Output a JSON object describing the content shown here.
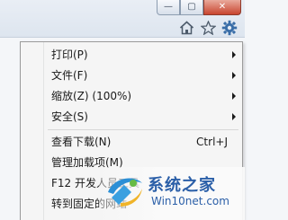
{
  "window": {
    "controls": [
      {
        "name": "minimize-button",
        "glyph": "—"
      },
      {
        "name": "maximize-button",
        "glyph": "▢"
      },
      {
        "name": "close-button",
        "glyph": "✕"
      }
    ]
  },
  "toolbar": {
    "icons": [
      "home-icon",
      "favorites-star-icon",
      "tools-gear-icon"
    ]
  },
  "menu": {
    "items": [
      {
        "label": "打印(P)",
        "shortcut": "",
        "submenu": true
      },
      {
        "label": "文件(F)",
        "shortcut": "",
        "submenu": true
      },
      {
        "label": "缩放(Z) (100%)",
        "shortcut": "",
        "submenu": true
      },
      {
        "label": "安全(S)",
        "shortcut": "",
        "submenu": true
      },
      {
        "label": "查看下载(N)",
        "shortcut": "Ctrl+J",
        "submenu": false
      },
      {
        "label": "管理加载项(M)",
        "shortcut": "",
        "submenu": false
      },
      {
        "label": "F12 开发人员工具",
        "shortcut": "",
        "submenu": false
      },
      {
        "label": "转到固定的网站",
        "shortcut": "",
        "submenu": false
      }
    ]
  },
  "watermark": {
    "title": "系统之家",
    "url": "Win10net.com"
  },
  "colors": {
    "accent": "#2b5fa8",
    "close": "#c8452f",
    "icon": "#3a6ea8"
  }
}
